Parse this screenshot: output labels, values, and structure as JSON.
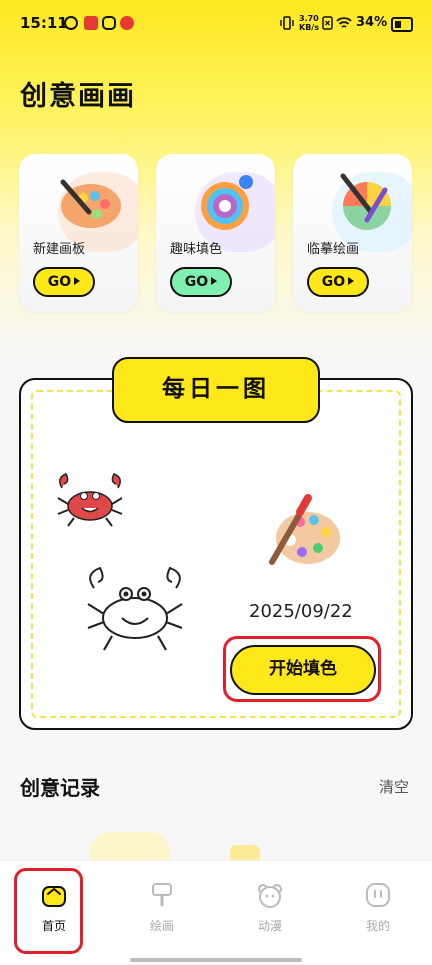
{
  "status_bar": {
    "time": "15:11",
    "network_speed_value": "3.70",
    "network_speed_unit": "KB/s",
    "battery": "34%"
  },
  "page_title": "创意画画",
  "feature_cards": [
    {
      "label": "新建画板",
      "button": "GO",
      "accent": "#ffe81a"
    },
    {
      "label": "趣味填色",
      "button": "GO",
      "accent": "#7ff0b0"
    },
    {
      "label": "临摹绘画",
      "button": "GO",
      "accent": "#ffe81a"
    }
  ],
  "daily": {
    "tab_title": "每日一图",
    "date": "2025/09/22",
    "start_button": "开始填色"
  },
  "records": {
    "title": "创意记录",
    "clear": "清空"
  },
  "tabbar": [
    {
      "label": "首页",
      "icon": "home-icon",
      "active": true
    },
    {
      "label": "绘画",
      "icon": "brush-icon",
      "active": false
    },
    {
      "label": "动漫",
      "icon": "bear-icon",
      "active": false
    },
    {
      "label": "我的",
      "icon": "profile-icon",
      "active": false
    }
  ],
  "colors": {
    "brand_yellow": "#ffe81a",
    "highlight_red": "#e2202a"
  }
}
